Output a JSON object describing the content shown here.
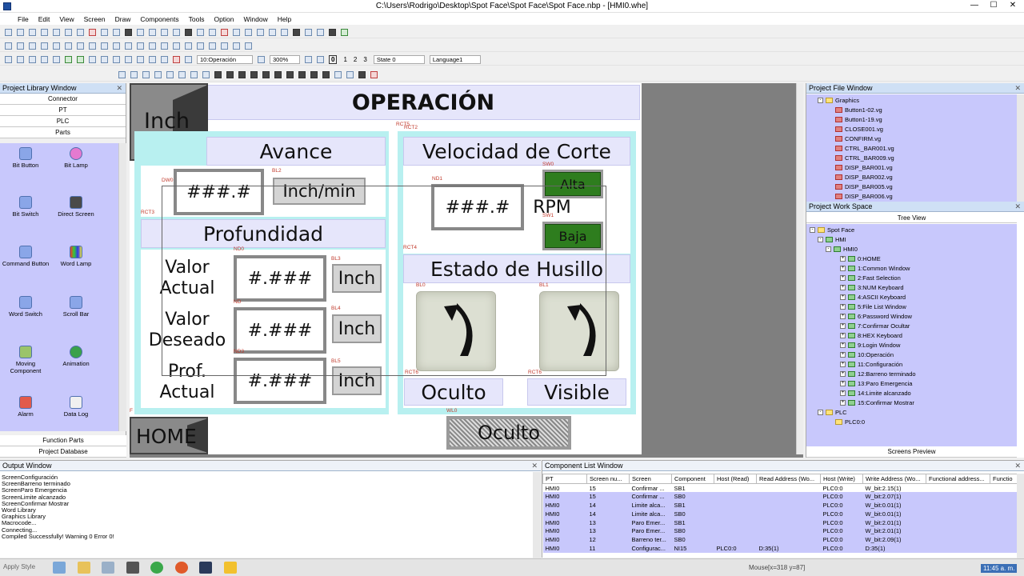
{
  "window": {
    "title": "C:\\Users\\Rodrigo\\Desktop\\Spot Face\\Spot Face\\Spot Face.nbp - [HMI0.whe]",
    "minimize": "—",
    "maximize": "☐",
    "close": "✕"
  },
  "menu": [
    "File",
    "Edit",
    "View",
    "Screen",
    "Draw",
    "Components",
    "Tools",
    "Option",
    "Window",
    "Help"
  ],
  "toolbar": {
    "screen_select": "10:Operación",
    "zoom": "300%",
    "state_buttons": [
      "0",
      "1",
      "2",
      "3"
    ],
    "state": "State 0",
    "language": "Language1"
  },
  "library": {
    "title": "Project Library Window",
    "categories": [
      "Connector",
      "PT",
      "PLC",
      "Parts"
    ],
    "parts": [
      "Bit Button",
      "Bit Lamp",
      "Bit Switch",
      "Direct Screen",
      "Command Button",
      "Word Lamp",
      "Word Switch",
      "Scroll Bar",
      "Moving Component",
      "Animation",
      "Alarm",
      "Data Log"
    ],
    "footer": [
      "Function Parts",
      "Project Database"
    ]
  },
  "hmi": {
    "title": "OPERACIÓN",
    "inch_button": "Inch",
    "home_button": "HOME",
    "avance": "Avance",
    "profundidad": "Profundidad",
    "velocidad": "Velocidad de Corte",
    "estado": "Estado de Husillo",
    "avance_value": "###.#",
    "avance_unit": "Inch/min",
    "rpm_value": "###.#",
    "rpm_unit": "RPM",
    "alta": "Alta",
    "baja": "Baja",
    "valor_actual": "Valor\nActual",
    "valor_deseado": "Valor\nDeseado",
    "prof_actual": "Prof.\nActual",
    "val1": "#.###",
    "val2": "#.###",
    "val3": "#.###",
    "inch1": "Inch",
    "inch2": "Inch",
    "inch3": "Inch",
    "oculto": "Oculto",
    "visible": "Visible",
    "bottom_word": "Oculto",
    "labels": {
      "rct5": "RCT5",
      "rct2": "RCT2",
      "dw": "DW0",
      "bl2": "BL2",
      "rct3": "RCT3",
      "nd1": "ND1",
      "sw0": "SW0",
      "sw1": "SW1",
      "nd0": "ND0",
      "bl3": "BL3",
      "rct4": "RCT4",
      "nd": "ND",
      "bl4": "BL4",
      "nd3": "ND3",
      "bl5": "BL5",
      "bl0": "BL0",
      "bl1": "BL1",
      "rct6a": "RCT6",
      "rct6b": "RCT6",
      "wl0": "WL0",
      "f": "F"
    }
  },
  "file_window": {
    "title": "Project File Window",
    "folder": "Graphics",
    "files": [
      "Button1-02.vg",
      "Button1-19.vg",
      "CLOSE001.vg",
      "CONFIRM.vg",
      "CTRL_BAR001.vg",
      "CTRL_BAR009.vg",
      "DISP_BAR001.vg",
      "DISP_BAR002.vg",
      "DISP_BAR005.vg",
      "DISP_BAR006.vg"
    ]
  },
  "work_space": {
    "title": "Project Work Space",
    "tab": "Tree View",
    "root": "Spot Face",
    "hmi": "HMI",
    "hmi0": "HMI0",
    "screens": [
      "0:HOME",
      "1:Common Window",
      "2:Fast Selection",
      "3:NUM Keyboard",
      "4:ASCII Keyboard",
      "5:File List Window",
      "6:Password Window",
      "7:Confirmar Ocultar",
      "8:HEX Keyboard",
      "9:Login Window",
      "10:Operación",
      "11:Configuración",
      "12:Barreno terminado",
      "13:Paro Emergencia",
      "14:Limite alcanzado",
      "15:Confirmar Mostrar"
    ],
    "plc": "PLC",
    "plc0": "PLC0:0",
    "footer": "Screens Preview"
  },
  "output": {
    "title": "Output Window",
    "lines": [
      "ScreenConfiguración",
      "ScreenBarreno terminado",
      "ScreenParo Emergencia",
      "ScreenLimite alcanzado",
      "ScreenConfirmar Mostrar",
      "Word Library",
      "Graphics Library",
      "Macrocode...",
      "Connecting...",
      "Compiled Successfully! Warning 0 Error 0!"
    ]
  },
  "components": {
    "title": "Component List Window",
    "columns": [
      "PT",
      "Screen nu...",
      "Screen",
      "Component",
      "Host (Read)",
      "Read Address (Wo...",
      "Host (Write)",
      "Write Address (Wo...",
      "Functional address...",
      "Functio"
    ],
    "rows": [
      [
        "HMI0",
        "15",
        "Confirmar ...",
        "SB1",
        "",
        "",
        "PLC0:0",
        "W_bit:2.15(1)",
        "",
        ""
      ],
      [
        "HMI0",
        "15",
        "Confirmar ...",
        "SB0",
        "",
        "",
        "PLC0:0",
        "W_bit:2.07(1)",
        "",
        ""
      ],
      [
        "HMI0",
        "14",
        "Limite alca...",
        "SB1",
        "",
        "",
        "PLC0:0",
        "W_bit:0.01(1)",
        "",
        ""
      ],
      [
        "HMI0",
        "14",
        "Limite alca...",
        "SB0",
        "",
        "",
        "PLC0:0",
        "W_bit:0.01(1)",
        "",
        ""
      ],
      [
        "HMI0",
        "13",
        "Paro Emer...",
        "SB1",
        "",
        "",
        "PLC0:0",
        "W_bit:2.01(1)",
        "",
        ""
      ],
      [
        "HMI0",
        "13",
        "Paro Emer...",
        "SB0",
        "",
        "",
        "PLC0:0",
        "W_bit:2.01(1)",
        "",
        ""
      ],
      [
        "HMI0",
        "12",
        "Barreno ter...",
        "SB0",
        "",
        "",
        "PLC0:0",
        "W_bit:2.09(1)",
        "",
        ""
      ],
      [
        "HMI0",
        "11",
        "Configurac...",
        "NI15",
        "PLC0:0",
        "D:35(1)",
        "PLC0:0",
        "D:35(1)",
        "",
        ""
      ]
    ]
  },
  "status": {
    "apply": "Apply Style",
    "mouse": "Mouse[x=318  y=87]",
    "clock": "11:45 a. m."
  }
}
